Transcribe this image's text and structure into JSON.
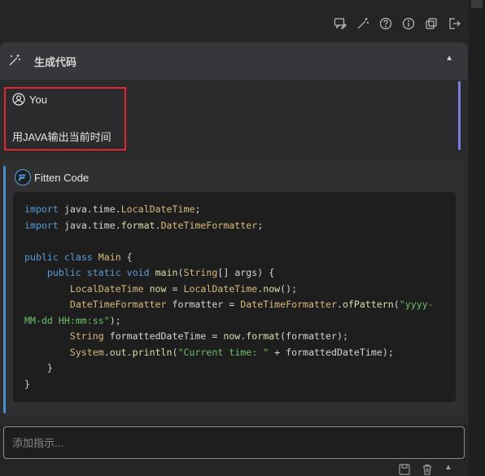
{
  "header": {
    "title": "生成代码"
  },
  "toolbar": {
    "icons": [
      "chat-edit-icon",
      "magic-wand-icon",
      "help-icon",
      "info-icon",
      "copy-icon",
      "exit-icon"
    ]
  },
  "user": {
    "name": "You",
    "message": "用JAVA输出当前时间"
  },
  "assistant": {
    "name": "Fitten Code"
  },
  "code": {
    "language": "java",
    "lines": [
      "import java.time.LocalDateTime;",
      "import java.time.format.DateTimeFormatter;",
      "",
      "public class Main {",
      "    public static void main(String[] args) {",
      "        LocalDateTime now = LocalDateTime.now();",
      "        DateTimeFormatter formatter = DateTimeFormatter.ofPattern(\"yyyy-",
      "MM-dd HH:mm:ss\");",
      "        String formattedDateTime = now.format(formatter);",
      "        System.out.println(\"Current time: \" + formattedDateTime);",
      "    }",
      "}"
    ]
  },
  "input": {
    "placeholder": "添加指示..."
  },
  "colors": {
    "accent_user": "#7b7cdc",
    "accent_assistant": "#4a8fc9",
    "highlight_border": "#e3262e"
  }
}
